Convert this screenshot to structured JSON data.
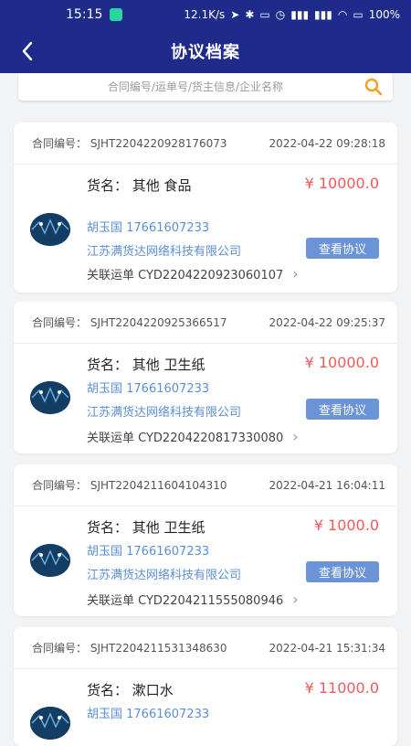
{
  "status_bar": {
    "time": "15:15",
    "network_speed": "12.1K/s",
    "battery": "100%",
    "icons": [
      "app-badge-icon",
      "location-icon",
      "bluetooth-icon",
      "vibrate-icon",
      "alarm-icon",
      "signal-icon",
      "signal-icon",
      "wifi-icon",
      "battery-icon"
    ]
  },
  "header": {
    "title": "协议档案",
    "back_icon": "back-chevron-icon"
  },
  "search": {
    "placeholder": "合同编号/运单号/货主信息/企业名称",
    "icon": "search-icon"
  },
  "colors": {
    "header_bg": "#1f2b8a",
    "price": "#f0595a",
    "link": "#5b8fd6",
    "button": "#6b93d8"
  },
  "contracts": [
    {
      "contract_label": "合同编号：",
      "contract_no": "SJHT2204220928176073",
      "datetime": "2022-04-22 09:28:18",
      "goods": "货名：  其他 食品",
      "price": "¥ 10000.0",
      "person": "胡玉国 17661607233",
      "company": "江苏满货达网络科技有限公司",
      "button": "查看协议",
      "waybill": "关联运单 CYD2204220923060107"
    },
    {
      "contract_label": "合同编号：",
      "contract_no": "SJHT2204220925366517",
      "datetime": "2022-04-22 09:25:37",
      "goods": "货名：  其他 卫生纸",
      "price": "¥ 10000.0",
      "person": "胡玉国 17661607233",
      "company": "江苏满货达网络科技有限公司",
      "button": "查看协议",
      "waybill": "关联运单 CYD2204220817330080"
    },
    {
      "contract_label": "合同编号：",
      "contract_no": "SJHT2204211604104310",
      "datetime": "2022-04-21 16:04:11",
      "goods": "货名：  其他 卫生纸",
      "price": "¥ 1000.0",
      "person": "胡玉国 17661607233",
      "company": "江苏满货达网络科技有限公司",
      "button": "查看协议",
      "waybill": "关联运单 CYD2204211555080946"
    },
    {
      "contract_label": "合同编号：",
      "contract_no": "SJHT2204211531348630",
      "datetime": "2022-04-21 15:31:34",
      "goods": "货名：   漱口水",
      "price": "¥ 11000.0",
      "person": "胡玉国 17661607233",
      "company": "",
      "button": "",
      "waybill": ""
    }
  ]
}
